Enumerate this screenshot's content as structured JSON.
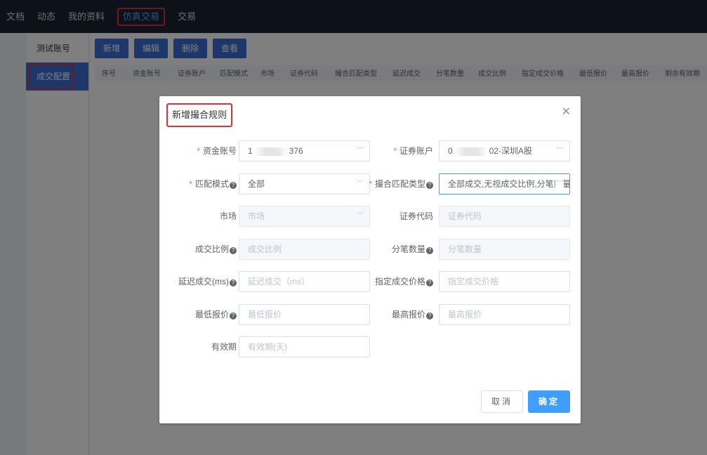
{
  "topnav": {
    "items": [
      {
        "label": "文档"
      },
      {
        "label": "动态"
      },
      {
        "label": "我的资料"
      },
      {
        "label": "仿真交易"
      },
      {
        "label": "交易"
      }
    ],
    "active_index": 3
  },
  "sidebar": {
    "items": [
      {
        "label": "测试账号"
      },
      {
        "label": "成交配置"
      }
    ]
  },
  "toolbar": {
    "add": "新增",
    "edit": "编辑",
    "delete": "删除",
    "view": "查看"
  },
  "table": {
    "columns": [
      "序号",
      "资金账号",
      "证券账户",
      "匹配模式",
      "市场",
      "证券代码",
      "撮合匹配类型",
      "延迟成交",
      "分笔数量",
      "成交比例",
      "指定成交价格",
      "最低报价",
      "最高报价",
      "剩余有效期"
    ]
  },
  "dialog": {
    "title": "新增撮合规则",
    "fields": {
      "fund_account": {
        "label": "资金账号",
        "value_prefix": "1",
        "value_suffix": "376"
      },
      "securities_account": {
        "label": "证券账户",
        "value_prefix": "0",
        "value_suffix": "02-深圳A股"
      },
      "match_mode": {
        "label": "匹配模式",
        "value": "全部"
      },
      "match_type": {
        "label": "撮合匹配类型",
        "value": "全部成交,无视成交比例,分笔数量"
      },
      "market": {
        "label": "市场",
        "placeholder": "市场"
      },
      "security_code": {
        "label": "证券代码",
        "placeholder": "证券代码"
      },
      "fill_ratio": {
        "label": "成交比例",
        "placeholder": "成交比例"
      },
      "split_quantity": {
        "label": "分笔数量",
        "placeholder": "分笔数量"
      },
      "delay": {
        "label": "延迟成交(ms)",
        "placeholder": "延迟成交（ms）"
      },
      "fill_price": {
        "label": "指定成交价格",
        "placeholder": "指定成交价格"
      },
      "min_price": {
        "label": "最低报价",
        "placeholder": "最低报价"
      },
      "max_price": {
        "label": "最高报价",
        "placeholder": "最高报价"
      },
      "validity": {
        "label": "有效期",
        "placeholder": "有效期(天)"
      }
    },
    "cancel": "取消",
    "confirm": "确定"
  }
}
